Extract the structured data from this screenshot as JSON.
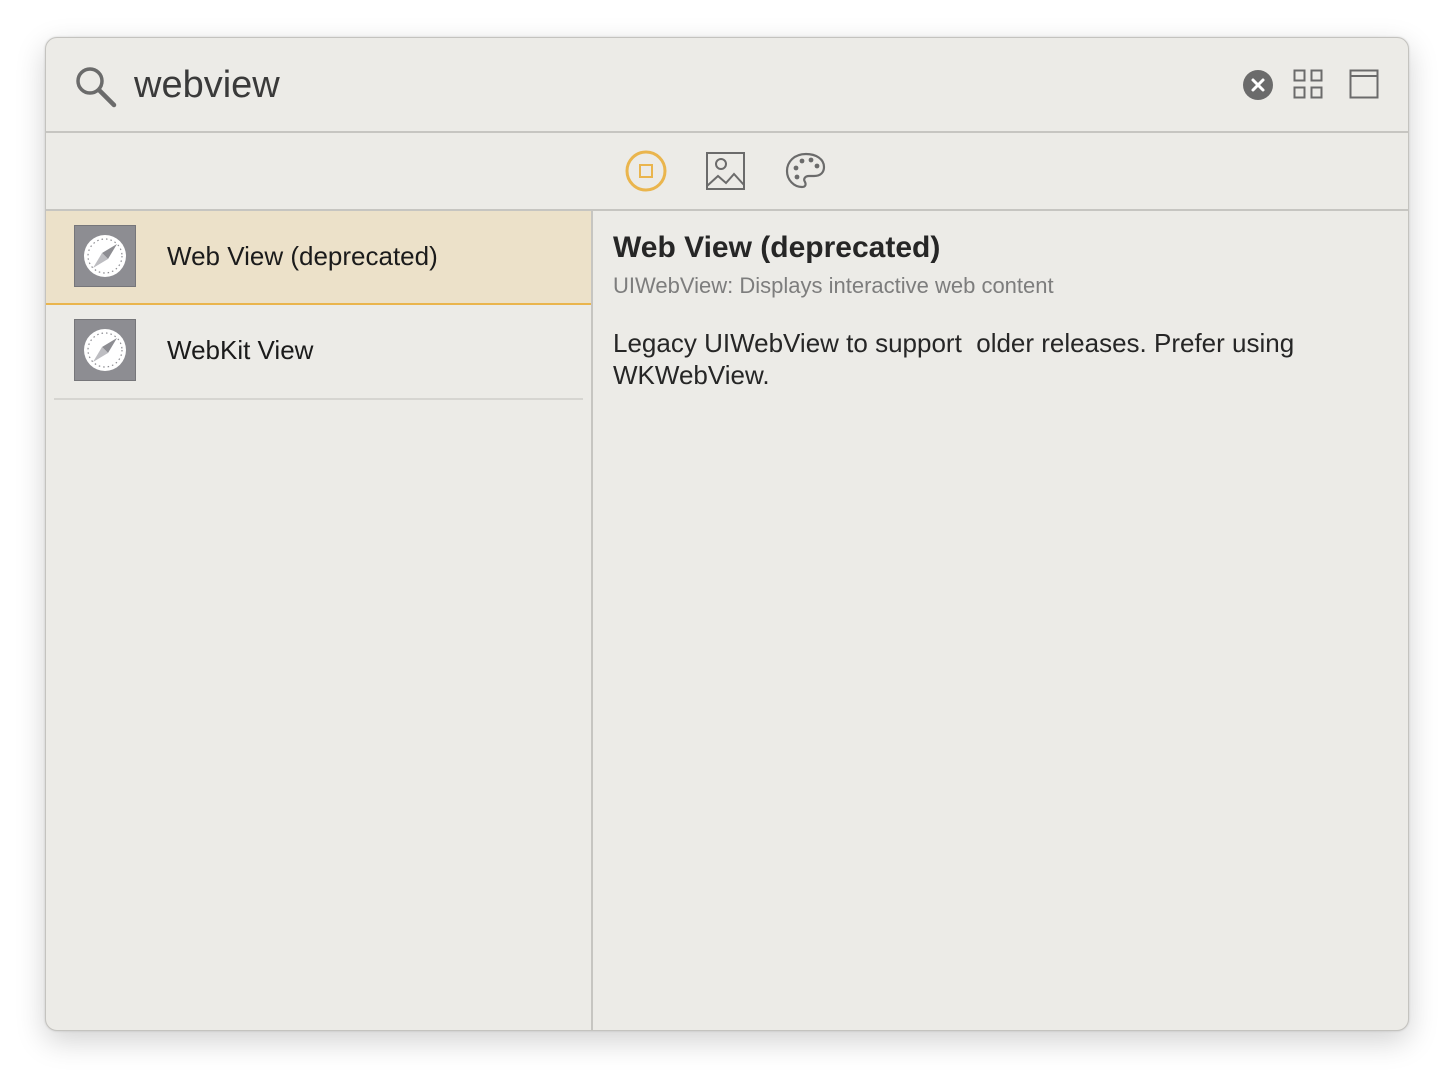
{
  "search": {
    "value": "webview",
    "icon": "search-icon"
  },
  "toolbar": {
    "clear_icon": "clear-icon",
    "grid_icon": "grid-view-icon",
    "detail_icon": "detail-view-icon"
  },
  "filter_tabs": [
    {
      "icon": "objects-icon",
      "selected": true
    },
    {
      "icon": "image-icon",
      "selected": false
    },
    {
      "icon": "color-palette-icon",
      "selected": false
    }
  ],
  "results": [
    {
      "label": "Web View (deprecated)",
      "icon": "compass-icon",
      "selected": true
    },
    {
      "label": "WebKit View",
      "icon": "compass-icon",
      "selected": false
    }
  ],
  "detail": {
    "title": "Web View (deprecated)",
    "subtitle": "UIWebView: Displays interactive web content",
    "body": "Legacy UIWebView to support  older releases. Prefer using WKWebView."
  },
  "colors": {
    "accent": "#eab54d",
    "selected_row": "#ece1c9",
    "background": "#ecebe7",
    "thumb": "#8d8d92"
  }
}
